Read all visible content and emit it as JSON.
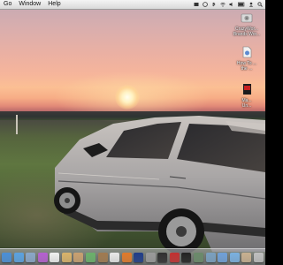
{
  "menubar": {
    "items": [
      "Go",
      "Window",
      "Help"
    ]
  },
  "desktop_icons": [
    {
      "label_line1": "CrazyWor...",
      "label_line2": "Brands Wor...",
      "icon": "disk-image-icon"
    },
    {
      "label_line1": "How To ...",
      "label_line2": "the ...",
      "icon": "document-icon"
    },
    {
      "label_line1": "Ma...",
      "label_line2": "Un...",
      "icon": "red-file-icon"
    }
  ],
  "dock": {
    "icons": [
      {
        "name": "finder-icon",
        "color": "#4a8fd6"
      },
      {
        "name": "safari-icon",
        "color": "#5aa2e0"
      },
      {
        "name": "mail-icon",
        "color": "#8aa7c8"
      },
      {
        "name": "itunes-icon",
        "color": "#b55fd0"
      },
      {
        "name": "calendar-icon",
        "color": "#f0f0f0"
      },
      {
        "name": "preview-icon",
        "color": "#d9b36a"
      },
      {
        "name": "photo-icon",
        "color": "#c9a070"
      },
      {
        "name": "ichat-icon",
        "color": "#6ab06a"
      },
      {
        "name": "address-book-icon",
        "color": "#a07a50"
      },
      {
        "name": "textedit-icon",
        "color": "#e8e8e8"
      },
      {
        "name": "firefox-icon",
        "color": "#e07a2a"
      },
      {
        "name": "photoshop-icon",
        "color": "#1f3c88"
      },
      {
        "name": "system-prefs-icon",
        "color": "#9a9a9a"
      },
      {
        "name": "dvd-player-icon",
        "color": "#303030"
      },
      {
        "name": "red-app-icon",
        "color": "#c23030"
      },
      {
        "name": "terminal-icon",
        "color": "#222222"
      },
      {
        "name": "activity-monitor-icon",
        "color": "#6a8a6a"
      },
      {
        "name": "network-icon",
        "color": "#7aa0c0"
      },
      {
        "name": "downloads-folder-icon",
        "color": "#6fa0d8"
      },
      {
        "name": "documents-folder-icon",
        "color": "#7ab0e0"
      },
      {
        "name": "stack-icon",
        "color": "#c8b090"
      },
      {
        "name": "trash-icon",
        "color": "#bfbfbf"
      }
    ]
  }
}
